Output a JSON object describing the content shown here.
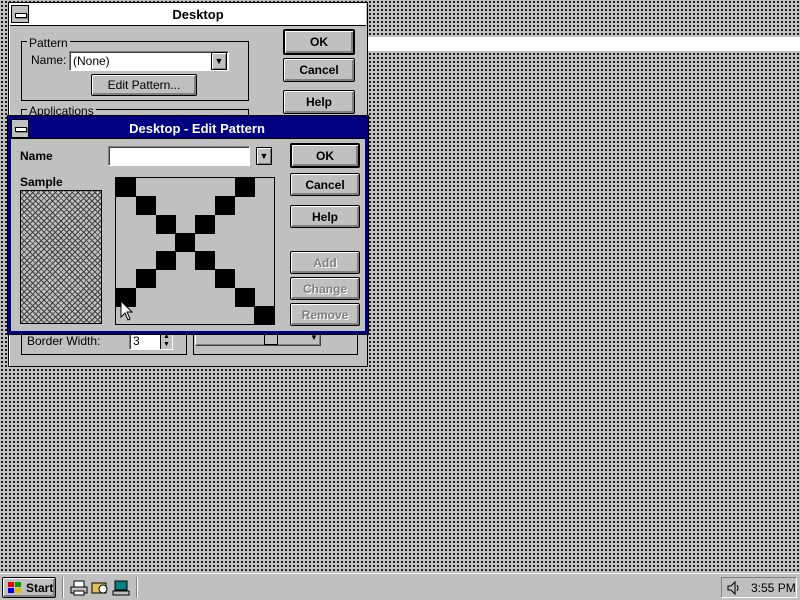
{
  "desktop_dialog": {
    "title": "Desktop",
    "pattern_group_label": "Pattern",
    "name_label": "Name:",
    "name_value": "(None)",
    "edit_pattern_button": "Edit Pattern...",
    "applications_group_label": "Applications",
    "border_width_label": "Border Width:",
    "border_width_value": "3",
    "ok_button": "OK",
    "cancel_button": "Cancel",
    "help_button": "Help"
  },
  "edit_pattern_dialog": {
    "title": "Desktop - Edit Pattern",
    "name_label": "Name",
    "name_value": "",
    "sample_label": "Sample",
    "ok_button": "OK",
    "cancel_button": "Cancel",
    "help_button": "Help",
    "add_button": "Add",
    "change_button": "Change",
    "remove_button": "Remove",
    "pattern_grid": [
      [
        1,
        0,
        0,
        0,
        0,
        0,
        1,
        0
      ],
      [
        0,
        1,
        0,
        0,
        0,
        1,
        0,
        0
      ],
      [
        0,
        0,
        1,
        0,
        1,
        0,
        0,
        0
      ],
      [
        0,
        0,
        0,
        1,
        0,
        0,
        0,
        0
      ],
      [
        0,
        0,
        1,
        0,
        1,
        0,
        0,
        0
      ],
      [
        0,
        1,
        0,
        0,
        0,
        1,
        0,
        0
      ],
      [
        1,
        0,
        0,
        0,
        0,
        0,
        1,
        0
      ],
      [
        0,
        0,
        0,
        0,
        0,
        0,
        0,
        1
      ]
    ]
  },
  "taskbar": {
    "start_label": "Start",
    "clock": "3:55 PM",
    "quick_launch_icons": [
      "printer-icon",
      "explorer-icon",
      "network-icon"
    ],
    "tray_icon": "speaker-icon"
  },
  "colors": {
    "title_active": "#000080",
    "face": "#c0c0c0",
    "shadow": "#808080"
  }
}
